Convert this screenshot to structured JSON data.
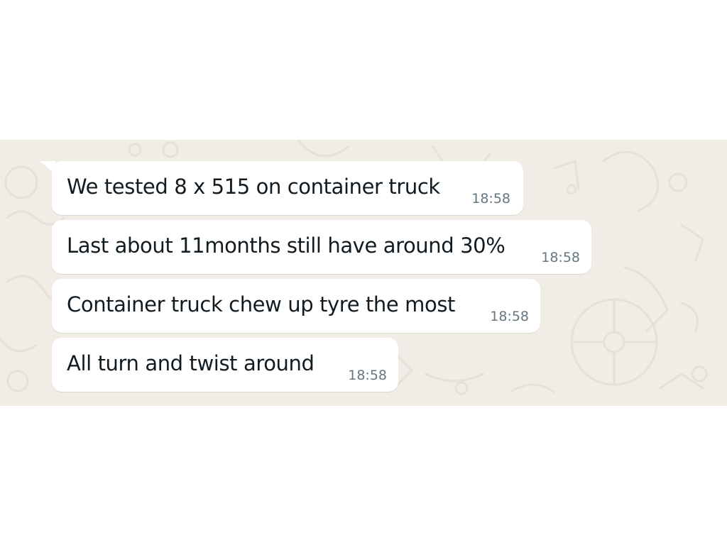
{
  "messages": [
    {
      "text": "We tested 8 x 515 on container truck",
      "time": "18:58"
    },
    {
      "text": "Last about 11months still have around 30%",
      "time": "18:58"
    },
    {
      "text": "Container truck chew up tyre the most",
      "time": "18:58"
    },
    {
      "text": "All turn and twist around",
      "time": "18:58"
    }
  ],
  "colors": {
    "wallpaper": "#f1ede6",
    "bubble": "#ffffff",
    "text": "#111b21",
    "timestamp": "#667781"
  }
}
